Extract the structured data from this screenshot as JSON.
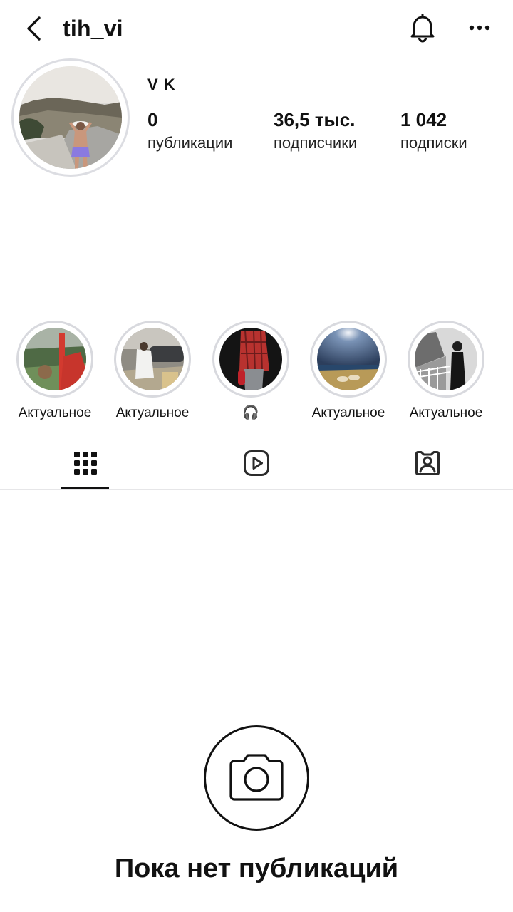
{
  "header": {
    "username": "tih_vi",
    "icons": {
      "back": "chevron-left-icon",
      "notifications": "bell-icon",
      "more": "more-horizontal-icon"
    }
  },
  "profile": {
    "display_name": "V K",
    "stats": [
      {
        "value": "0",
        "label": "публикации"
      },
      {
        "value": "36,5 тыс.",
        "label": "подписчики"
      },
      {
        "value": "1 042",
        "label": "подписки"
      }
    ]
  },
  "highlights": [
    {
      "label": "Актуальное"
    },
    {
      "label": "Актуальное"
    },
    {
      "label": "🎧"
    },
    {
      "label": "Актуальное"
    },
    {
      "label": "Актуальное"
    }
  ],
  "tabs": [
    {
      "icon": "grid-icon",
      "active": true
    },
    {
      "icon": "reels-icon",
      "active": false
    },
    {
      "icon": "tagged-icon",
      "active": false
    }
  ],
  "empty_state": {
    "icon": "camera-icon",
    "title": "Пока нет публикаций"
  }
}
